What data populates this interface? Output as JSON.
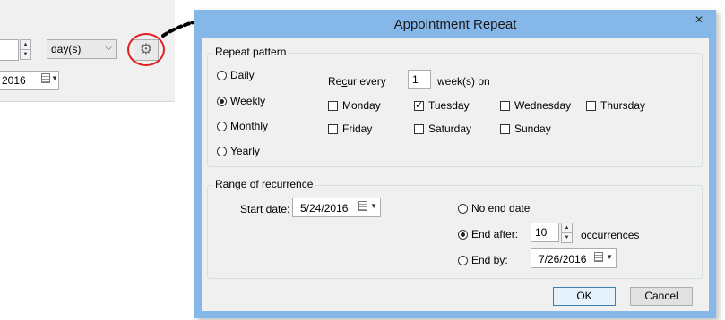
{
  "background_window": {
    "spin_value": "",
    "unit_select": "day(s)",
    "date_value": "2016"
  },
  "dialog": {
    "title": "Appointment Repeat",
    "close_glyph": "✕"
  },
  "repeat_pattern": {
    "legend": "Repeat pattern",
    "options": [
      {
        "label": "Daily",
        "selected": false
      },
      {
        "label": "Weekly",
        "selected": true
      },
      {
        "label": "Monthly",
        "selected": false
      },
      {
        "label": "Yearly",
        "selected": false
      }
    ],
    "recur_label_pre": "Re",
    "recur_label_accel": "c",
    "recur_label_post": "ur every",
    "recur_value": "1",
    "recur_suffix": "week(s) on",
    "days": [
      {
        "label": "Monday",
        "checked": false
      },
      {
        "label": "Tuesday",
        "checked": true
      },
      {
        "label": "Wednesday",
        "checked": false
      },
      {
        "label": "Thursday",
        "checked": false
      },
      {
        "label": "Friday",
        "checked": false
      },
      {
        "label": "Saturday",
        "checked": false
      },
      {
        "label": "Sunday",
        "checked": false
      }
    ]
  },
  "range": {
    "legend": "Range of recurrence",
    "start_label": "Start date:",
    "start_value": "5/24/2016",
    "no_end_label": "No end date",
    "end_after_label": "End after:",
    "end_after_value": "10",
    "occurrences_label": "occurrences",
    "end_by_label": "End by:",
    "end_by_value": "7/26/2016",
    "selected": "end_after"
  },
  "buttons": {
    "ok": "OK",
    "cancel": "Cancel"
  },
  "colors": {
    "dialog_frame": "#86b7e9",
    "highlight_circle": "#e02020"
  },
  "icons": {
    "gear": "gear-icon",
    "calendar": "calendar-icon",
    "arrow": "dotted-arrow"
  }
}
